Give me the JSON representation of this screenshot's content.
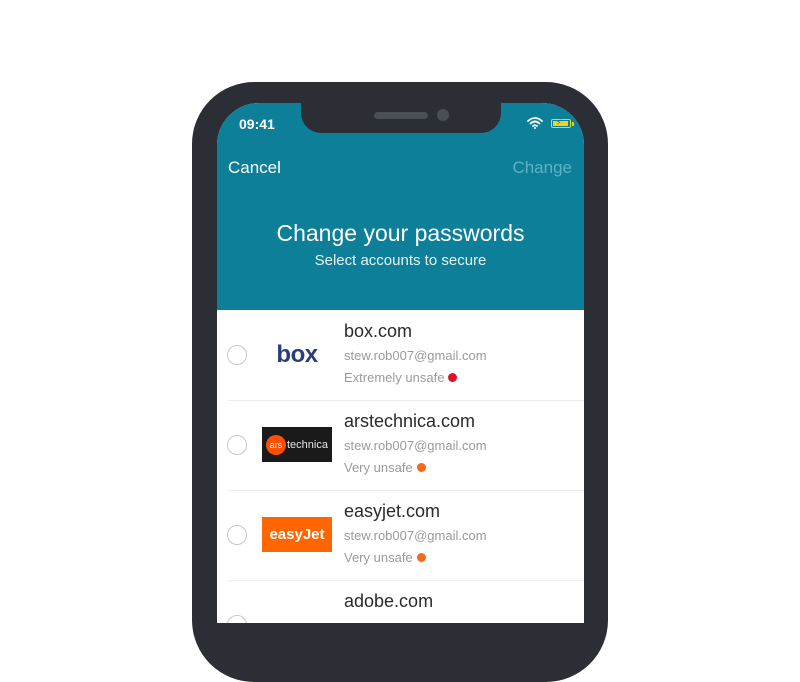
{
  "status_bar": {
    "time": "09:41",
    "battery_color": "#f3d21f"
  },
  "nav": {
    "cancel_label": "Cancel",
    "change_label": "Change"
  },
  "header": {
    "title": "Change your passwords",
    "subtitle": "Select accounts to secure",
    "background_color": "#0e7f99"
  },
  "accounts": [
    {
      "site": "box.com",
      "email": "stew.rob007@gmail.com",
      "status": "Extremely unsafe",
      "status_color": "#e0112b",
      "logo_text": "box",
      "selected": false
    },
    {
      "site": "arstechnica.com",
      "email": "stew.rob007@gmail.com",
      "status": "Very unsafe",
      "status_color": "#f36a1d",
      "logo_text": "ars technica",
      "logo_mark": "ars",
      "logo_word": "technica",
      "selected": false
    },
    {
      "site": "easyjet.com",
      "email": "stew.rob007@gmail.com",
      "status": "Very unsafe",
      "status_color": "#f36a1d",
      "logo_text": "easyJet",
      "selected": false
    },
    {
      "site": "adobe.com",
      "selected": false
    }
  ]
}
